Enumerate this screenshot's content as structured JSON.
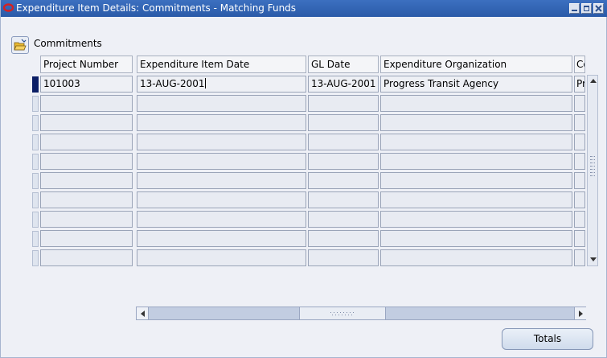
{
  "window": {
    "title": "Expenditure Item Details: Commitments - Matching Funds",
    "icon": "oracle-icon",
    "controls": [
      "minimize-icon",
      "restore-icon",
      "close-icon"
    ]
  },
  "section": {
    "label": "Commitments",
    "icon": "folder-open-icon"
  },
  "table": {
    "columns": [
      "Project Number",
      "Expenditure Item Date",
      "GL Date",
      "Expenditure Organization",
      "Co"
    ],
    "rows": [
      [
        "101003",
        "13-AUG-2001",
        "13-AUG-2001",
        "Progress Transit Agency",
        "Pr"
      ]
    ],
    "visible_row_count": 10
  },
  "buttons": {
    "totals": "Totals"
  },
  "colors": {
    "titlebar": "#2f62b2",
    "current_record": "#0c1f66",
    "background": "#eef0f6"
  }
}
